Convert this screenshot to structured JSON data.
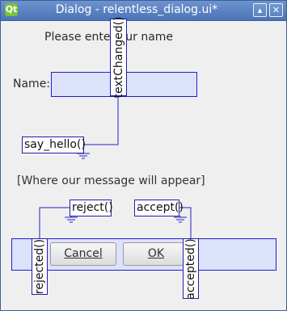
{
  "window": {
    "title": "Dialog - relentless_dialog.ui*",
    "app_icon_glyph": "Qt",
    "minimize_glyph": "▴",
    "close_glyph": "✕"
  },
  "form": {
    "prompt_text": "Please enter our name",
    "name_label": "Name:",
    "name_field_value": "",
    "message_text": "[Where our message will appear]"
  },
  "buttons": {
    "cancel": "Cancel",
    "ok": "OK"
  },
  "connections": {
    "text_changed_signal": "textChanged()",
    "say_hello_slot": "say_hello()",
    "reject_slot": "reject()",
    "accept_slot": "accept()",
    "rejected_signal": "rejected()",
    "accepted_signal": "accepted()"
  },
  "colors": {
    "connection_line": "#2020c8",
    "selection_fill": "#dde2fb",
    "titlebar": "#5a82c2"
  }
}
